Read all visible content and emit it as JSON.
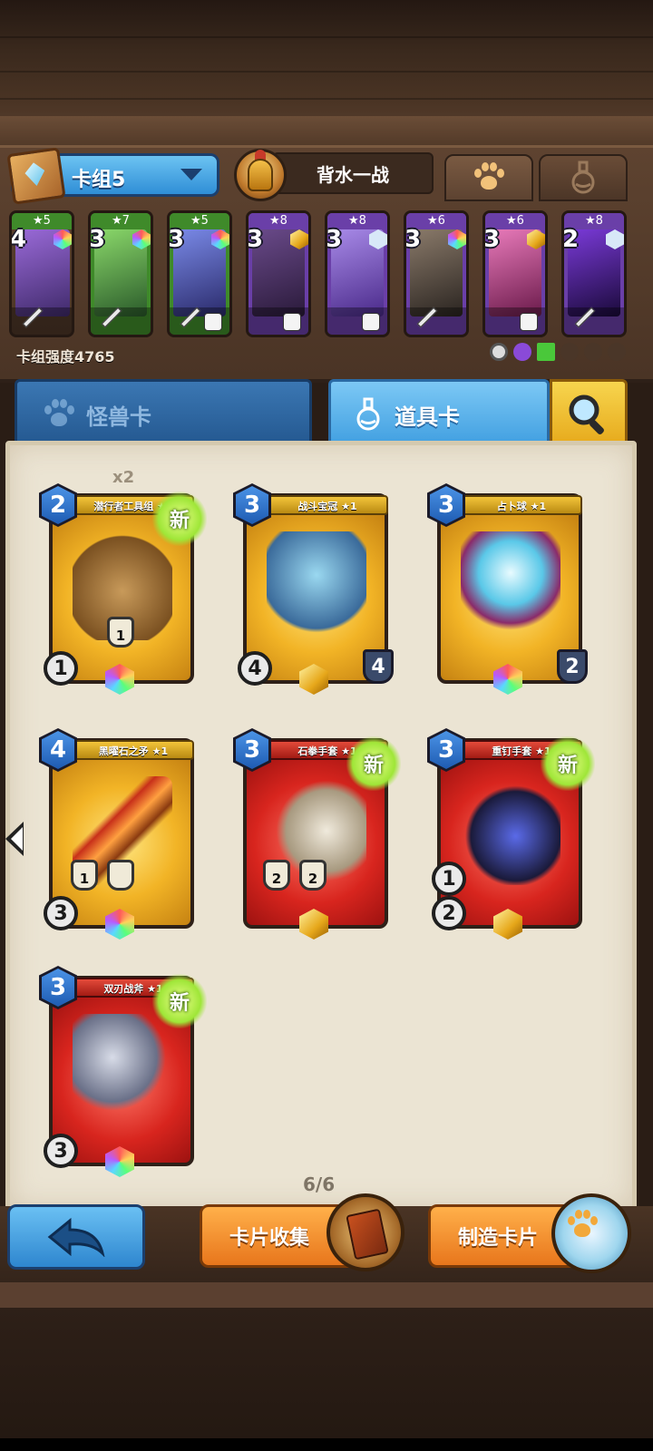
{
  "deck": {
    "name": "卡组5",
    "hero_name": "背水一战",
    "strength_label": "卡组强度4765"
  },
  "deck_cards": [
    {
      "stars": "★5",
      "cost": "4",
      "color": "#3f8a2a",
      "art": "#6b3fa0"
    },
    {
      "stars": "★7",
      "cost": "3",
      "color": "#3f8a2a",
      "art": "#4a8a3a"
    },
    {
      "stars": "★5",
      "cost": "3",
      "color": "#3f8a2a",
      "art": "#3a4a9a"
    },
    {
      "stars": "★8",
      "cost": "3",
      "color": "#6a3fa8",
      "art": "#4a2a6a"
    },
    {
      "stars": "★8",
      "cost": "3",
      "color": "#6a3fa8",
      "art": "#7a5acc"
    },
    {
      "stars": "★6",
      "cost": "3",
      "color": "#6a3fa8",
      "art": "#5a4a3a"
    },
    {
      "stars": "★6",
      "cost": "3",
      "color": "#6a3fa8",
      "art": "#c83a8a"
    },
    {
      "stars": "★8",
      "cost": "2",
      "color": "#6a3fa8",
      "art": "#3a1a6a"
    }
  ],
  "tabs": {
    "monster": "怪兽卡",
    "item": "道具卡"
  },
  "collection": {
    "duplicate_count": "x2",
    "page_indicator": "6/6",
    "cards": [
      {
        "name": "潜行者工具组 ★1",
        "cost": "2",
        "new": "新",
        "stat_left": "1",
        "badge": "1",
        "theme": "gold"
      },
      {
        "name": "战斗宝冠 ★1",
        "cost": "3",
        "stat_left": "4",
        "stat_right": "4",
        "theme": "gold"
      },
      {
        "name": "占卜球 ★1",
        "cost": "3",
        "stat_right": "2",
        "theme": "gold"
      },
      {
        "name": "黑曜石之矛 ★1",
        "cost": "4",
        "stat_left": "3",
        "badge_a": "1",
        "theme": "gold"
      },
      {
        "name": "石拳手套 ★1",
        "cost": "3",
        "new": "新",
        "badge_a": "2",
        "badge_b": "2",
        "theme": "red"
      },
      {
        "name": "重钉手套 ★1",
        "cost": "3",
        "new": "新",
        "stat_left_top": "1",
        "stat_left": "2",
        "theme": "red"
      },
      {
        "name": "双刃战斧 ★1",
        "cost": "3",
        "new": "新",
        "stat_left": "3",
        "theme": "red"
      }
    ]
  },
  "buttons": {
    "collect": "卡片收集",
    "craft": "制造卡片"
  }
}
